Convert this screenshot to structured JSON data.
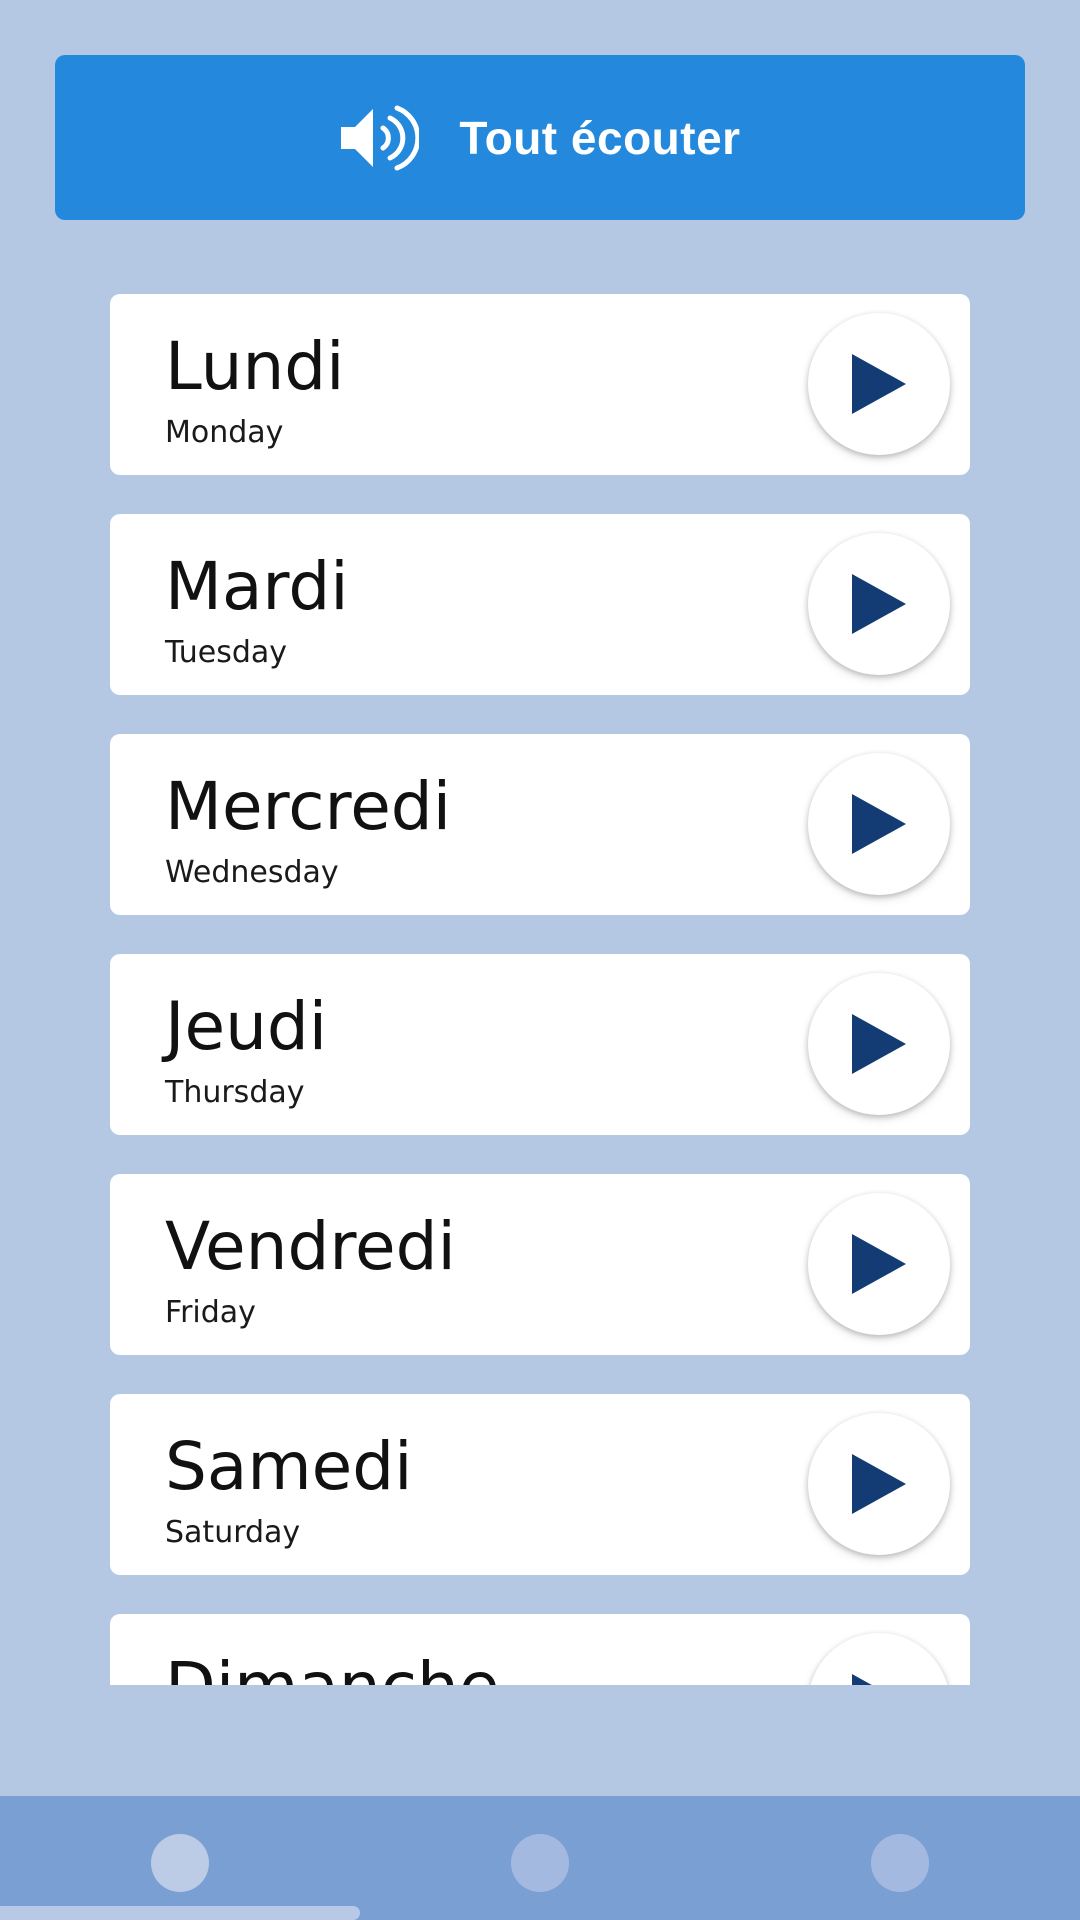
{
  "listen_all": {
    "label": "Tout écouter",
    "icon": "speaker-volume-icon"
  },
  "days": [
    {
      "fr": "Lundi",
      "en": "Monday"
    },
    {
      "fr": "Mardi",
      "en": "Tuesday"
    },
    {
      "fr": "Mercredi",
      "en": "Wednesday"
    },
    {
      "fr": "Jeudi",
      "en": "Thursday"
    },
    {
      "fr": "Vendredi",
      "en": "Friday"
    },
    {
      "fr": "Samedi",
      "en": "Saturday"
    },
    {
      "fr": "Dimanche",
      "en": ""
    }
  ],
  "colors": {
    "background": "#b4c8e4",
    "accent": "#2489dd",
    "play_icon": "#143c74",
    "nav_bar": "#7a9fd3"
  },
  "bottom_nav": {
    "items": [
      {
        "icon": "nav-dot-icon",
        "state": "active"
      },
      {
        "icon": "nav-dot-icon",
        "state": "inactive"
      },
      {
        "icon": "nav-dot-icon",
        "state": "inactive"
      }
    ]
  }
}
